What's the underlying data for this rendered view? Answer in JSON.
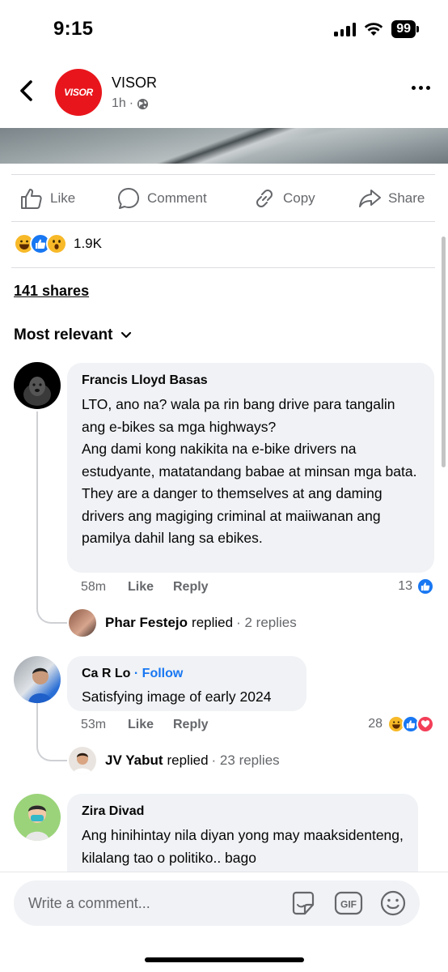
{
  "status_bar": {
    "time": "9:15",
    "battery": "99"
  },
  "post": {
    "page_name": "VISOR",
    "avatar_text": "VISOR",
    "time": "1h",
    "separator": "·"
  },
  "actions": {
    "like": "Like",
    "comment": "Comment",
    "copy": "Copy",
    "share": "Share"
  },
  "reactions": {
    "count": "1.9K"
  },
  "shares": "141 shares",
  "sort_label": "Most relevant",
  "comments": [
    {
      "author": "Francis Lloyd Basas",
      "paragraphs": [
        "LTO, ano na? wala pa rin bang drive para tangalin ang e-bikes sa mga highways?",
        "Ang dami kong nakikita na e-bike drivers na estudyante, matatandang babae at minsan mga bata.",
        "They are a danger to themselves at ang daming drivers ang magiging criminal at maiiwanan ang pamilya dahil lang sa ebikes."
      ],
      "time": "58m",
      "like_label": "Like",
      "reply_label": "Reply",
      "reaction_count": "13",
      "replier": "Phar Festejo",
      "replied_label": "replied",
      "replies_count": "· 2 replies"
    },
    {
      "author": "Ca R Lo",
      "follow_label": "· Follow",
      "paragraphs": [
        "Satisfying image of early 2024"
      ],
      "time": "53m",
      "like_label": "Like",
      "reply_label": "Reply",
      "reaction_count": "28",
      "replier": "JV Yabut",
      "replied_label": "replied",
      "replies_count": "· 23 replies"
    },
    {
      "author": "Zira Divad",
      "paragraphs": [
        "Ang hinihintay nila diyan yong may maaksidenteng, kilalang tao o politiko.. bago"
      ]
    }
  ],
  "composer": {
    "placeholder": "Write a comment..."
  },
  "colors": {
    "accent": "#1877f2",
    "brand_red": "#e8161c",
    "bubble": "#f0f2f5",
    "muted": "#65676b"
  }
}
